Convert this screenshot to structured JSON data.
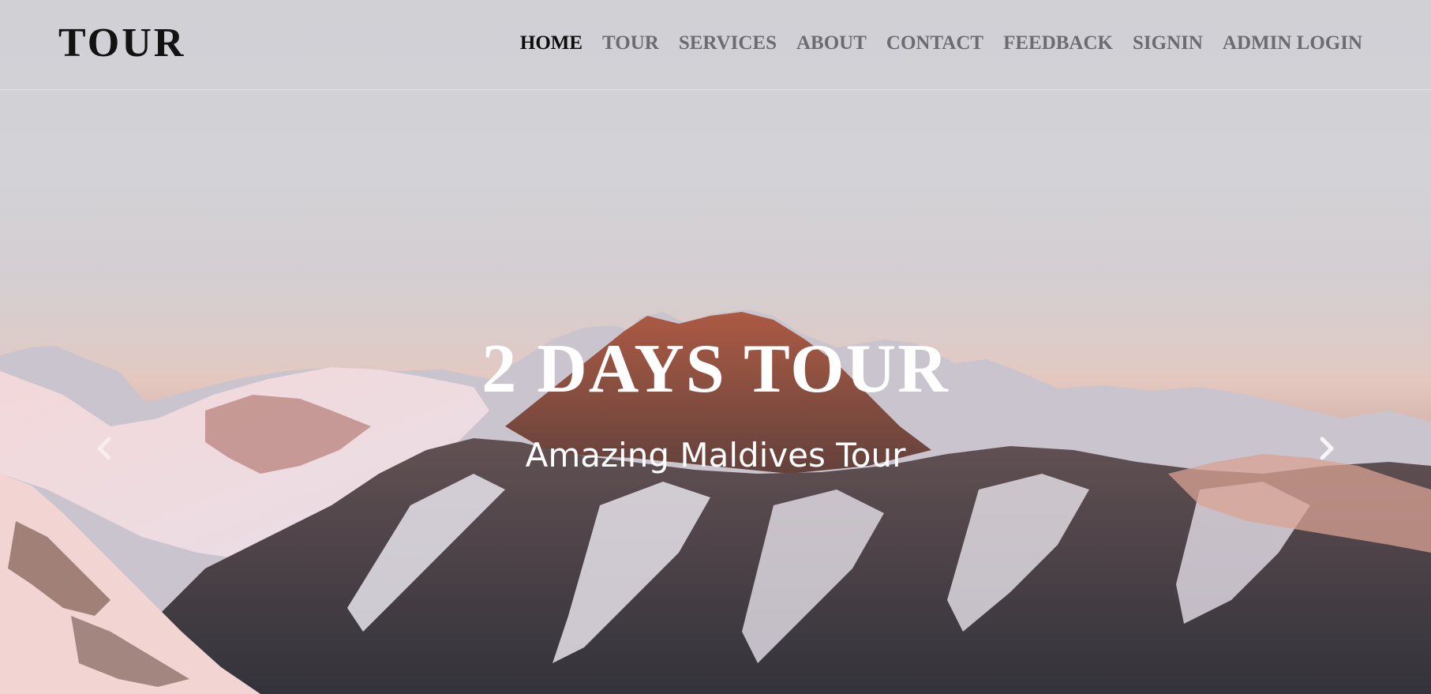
{
  "brand": {
    "name": "TOUR"
  },
  "nav": {
    "items": [
      {
        "label": "HOME",
        "active": true
      },
      {
        "label": "TOUR"
      },
      {
        "label": "SERVICES"
      },
      {
        "label": "ABOUT"
      },
      {
        "label": "CONTACT"
      },
      {
        "label": "FEEDBACK"
      },
      {
        "label": "SIGNIN"
      },
      {
        "label": "ADMIN LOGIN"
      }
    ]
  },
  "hero": {
    "title": "2 DAYS TOUR",
    "subtitle": "Amazing Maldives Tour",
    "background": "mountain-range-photo",
    "prev_icon": "chevron-left-icon",
    "next_icon": "chevron-right-icon"
  },
  "colors": {
    "nav_active": "#0d0d0d",
    "nav_inactive": "#6b6b70",
    "caption_text": "#ffffff"
  }
}
